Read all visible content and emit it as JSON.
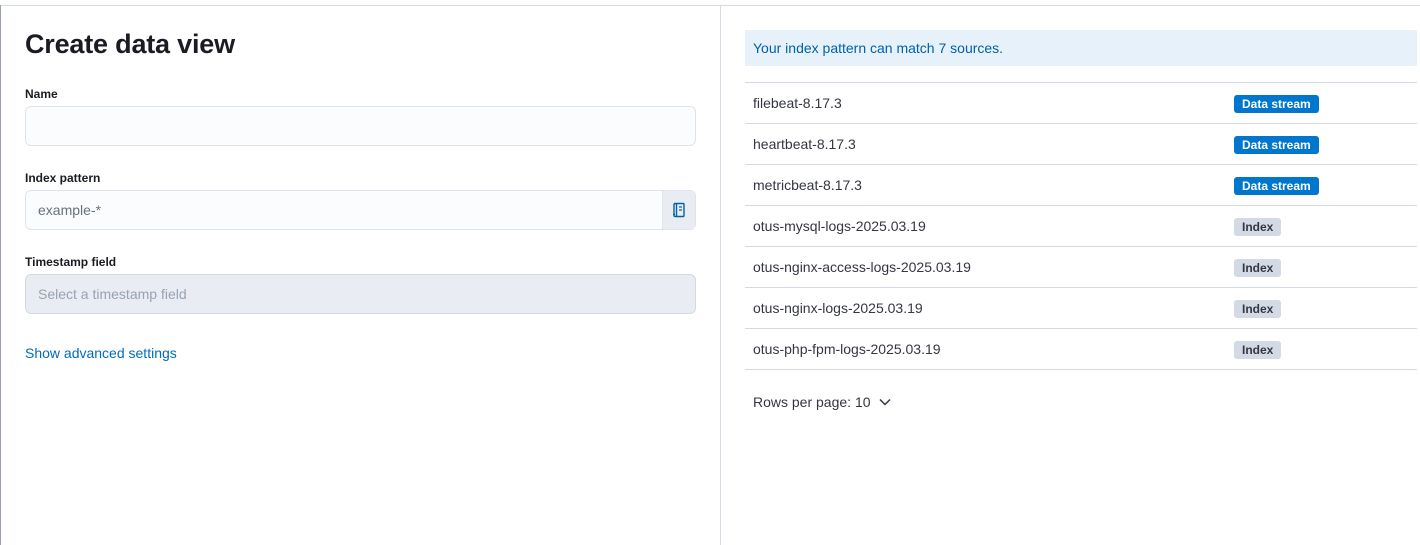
{
  "form": {
    "title": "Create data view",
    "name_label": "Name",
    "name_value": "",
    "index_label": "Index pattern",
    "index_placeholder": "example-*",
    "index_value": "",
    "timestamp_label": "Timestamp field",
    "timestamp_placeholder": "Select a timestamp field",
    "advanced_link": "Show advanced settings"
  },
  "sources": {
    "callout": "Your index pattern can match 7 sources.",
    "rows": [
      {
        "name": "filebeat-8.17.3",
        "type": "Data stream"
      },
      {
        "name": "heartbeat-8.17.3",
        "type": "Data stream"
      },
      {
        "name": "metricbeat-8.17.3",
        "type": "Data stream"
      },
      {
        "name": "otus-mysql-logs-2025.03.19",
        "type": "Index"
      },
      {
        "name": "otus-nginx-access-logs-2025.03.19",
        "type": "Index"
      },
      {
        "name": "otus-nginx-logs-2025.03.19",
        "type": "Index"
      },
      {
        "name": "otus-php-fpm-logs-2025.03.19",
        "type": "Index"
      }
    ],
    "rows_per_page_label": "Rows per page: 10"
  },
  "icons": {
    "index_append": "book-icon",
    "rows_per_page": "chevron-down-icon"
  },
  "colors": {
    "data_stream_badge": "#0077cc",
    "index_badge": "#d3dae6",
    "link": "#006bb8",
    "callout_bg": "#e6f1fa"
  }
}
